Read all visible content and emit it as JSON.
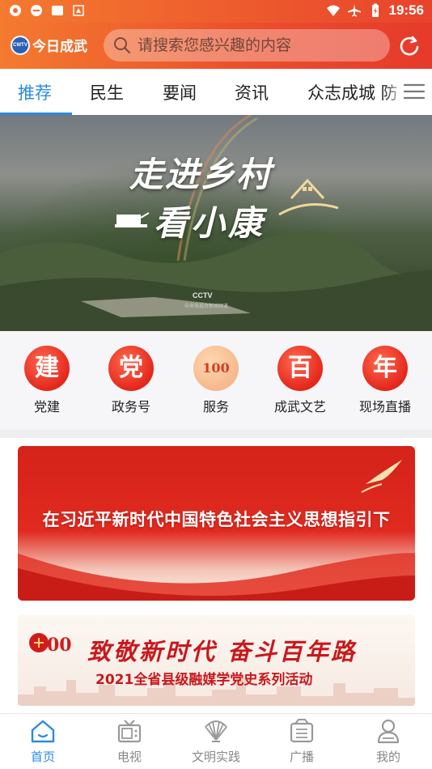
{
  "status_bar": {
    "time": "19:56"
  },
  "header": {
    "app_name": "今日成武",
    "logo_badge": "CWTV",
    "search_placeholder": "请搜索您感兴趣的内容"
  },
  "tabs": [
    {
      "label": "推荐",
      "active": true
    },
    {
      "label": "民生",
      "active": false
    },
    {
      "label": "要闻",
      "active": false
    },
    {
      "label": "资讯",
      "active": false
    },
    {
      "label": "众志成城 防",
      "active": false
    }
  ],
  "banner": {
    "line1": "走进乡村",
    "line2": "看小康",
    "watermark": "CCTV",
    "watermark_sub": "中央电视台新闻频道"
  },
  "quick_links": [
    {
      "glyph": "建",
      "label": "党建"
    },
    {
      "glyph": "党",
      "label": "政务号"
    },
    {
      "glyph": "100",
      "label": "服务"
    },
    {
      "glyph": "百",
      "label": "成武文艺"
    },
    {
      "glyph": "年",
      "label": "现场直播"
    }
  ],
  "feature_cards": {
    "card1_text": "在习近平新时代中国特色社会主义思想指引下",
    "card2_headline": "致敬新时代 奋斗百年路",
    "card2_subline": "2021全省县级融媒学党史系列活动"
  },
  "bottom_nav": [
    {
      "label": "首页",
      "icon": "home-icon",
      "active": true
    },
    {
      "label": "电视",
      "icon": "tv-icon",
      "active": false
    },
    {
      "label": "文明实践",
      "icon": "fan-icon",
      "active": false
    },
    {
      "label": "广播",
      "icon": "radio-icon",
      "active": false
    },
    {
      "label": "我的",
      "icon": "profile-icon",
      "active": false
    }
  ],
  "colors": {
    "accent": "#2a8ae0",
    "header_start": "#f47a2f",
    "header_end": "#e63a2b",
    "party_red": "#e4271c"
  }
}
